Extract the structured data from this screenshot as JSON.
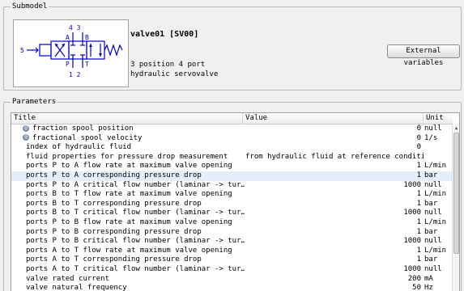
{
  "submodel": {
    "title": "Submodel",
    "name": "valve01 [SV00]",
    "description_lines": [
      "3 position 4 port",
      "hydraulic servovalve"
    ],
    "external_button": "External variables",
    "symbol_labels": {
      "top": "4 3",
      "a": "A",
      "b": "B",
      "p": "P",
      "t": "T",
      "bottom": "1 2",
      "left": "5"
    }
  },
  "parameters": {
    "title": "Parameters",
    "columns": {
      "title": "Title",
      "value": "Value",
      "unit": "Unit"
    },
    "rows": [
      {
        "title": "fraction spool position",
        "value": "0",
        "unit": "null",
        "icon": "variable-icon"
      },
      {
        "title": "fractional spool velocity",
        "value": "0",
        "unit": "1/s",
        "icon": "variable-icon"
      },
      {
        "title": "index of hydraulic fluid",
        "value": "0",
        "unit": ""
      },
      {
        "title": "fluid properties for pressure drop measurement",
        "value": "from hydraulic fluid at reference conditions",
        "unit": "",
        "value_left": true
      },
      {
        "title": "ports P to A flow rate at maximum valve opening",
        "value": "1",
        "unit": "L/min"
      },
      {
        "title": "ports P to A corresponding pressure drop",
        "value": "1",
        "unit": "bar",
        "selected": true
      },
      {
        "title": "ports P to A critical flow number (laminar -> tur…",
        "value": "1000",
        "unit": "null"
      },
      {
        "title": "ports B to T flow rate at maximum valve opening",
        "value": "1",
        "unit": "L/min"
      },
      {
        "title": "ports B to T corresponding pressure drop",
        "value": "1",
        "unit": "bar"
      },
      {
        "title": "ports B to T critical flow number (laminar -> tur…",
        "value": "1000",
        "unit": "null"
      },
      {
        "title": "ports P to B flow rate at maximum valve opening",
        "value": "1",
        "unit": "L/min"
      },
      {
        "title": "ports P to B corresponding pressure drop",
        "value": "1",
        "unit": "bar"
      },
      {
        "title": "ports P to B critical flow number (laminar -> tur…",
        "value": "1000",
        "unit": "null"
      },
      {
        "title": "ports A to T flow rate at maximum valve opening",
        "value": "1",
        "unit": "L/min"
      },
      {
        "title": "ports A to T corresponding pressure drop",
        "value": "1",
        "unit": "bar"
      },
      {
        "title": "ports A to T critical flow number (laminar -> tur…",
        "value": "1000",
        "unit": "null"
      },
      {
        "title": "valve rated current",
        "value": "200",
        "unit": "mA"
      },
      {
        "title": "valve natural frequency",
        "value": "50",
        "unit": "Hz"
      }
    ]
  },
  "colors": {
    "selection": "#e4eefb",
    "symbol_blue": "#0000cc"
  }
}
